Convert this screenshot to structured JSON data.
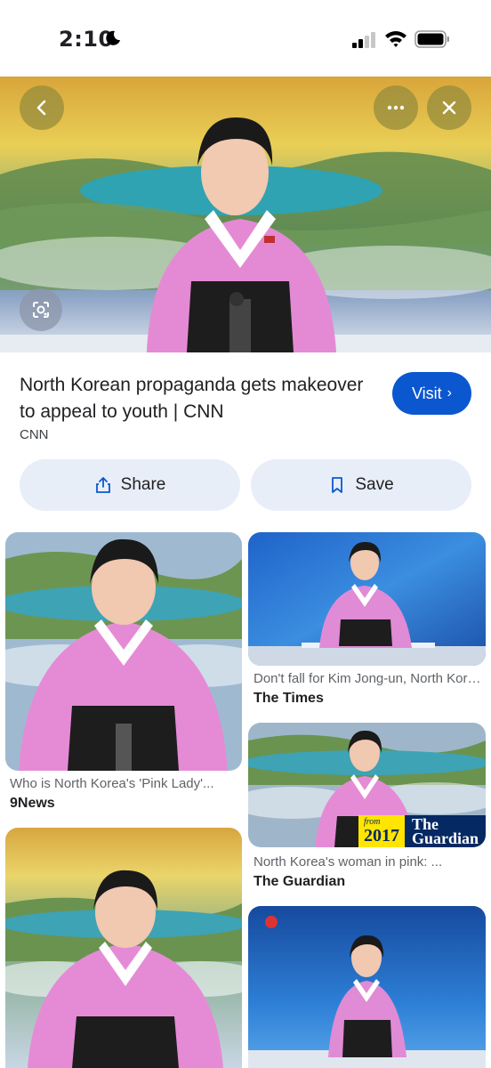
{
  "status_bar": {
    "time": "2:10"
  },
  "result": {
    "title": "North Korean propaganda gets makeover to appeal to youth | CNN",
    "source": "CNN",
    "visit_label": "Visit",
    "share_label": "Share",
    "save_label": "Save"
  },
  "grid": {
    "left": [
      {
        "caption": "Who is North Korea's 'Pink Lady'...",
        "source": "9News"
      },
      {
        "caption": "",
        "source": ""
      }
    ],
    "right": [
      {
        "caption": "Don't fall for Kim Jong-un, North Korea...",
        "source": "The Times"
      },
      {
        "caption": "North Korea's woman in pink: ...",
        "source": "The Guardian",
        "badge_from": "from",
        "badge_year": "2017",
        "badge_name_1": "The",
        "badge_name_2": "Guardian"
      },
      {
        "caption": "",
        "source": ""
      }
    ]
  },
  "colors": {
    "accent": "#0b57d0",
    "chip_bg": "#e8eef8",
    "pink": "#e07fd0"
  },
  "icons": [
    "moon-icon",
    "signal-icon",
    "wifi-icon",
    "battery-icon",
    "back-arrow-icon",
    "more-icon",
    "close-icon",
    "lens-icon",
    "share-icon",
    "bookmark-icon"
  ]
}
